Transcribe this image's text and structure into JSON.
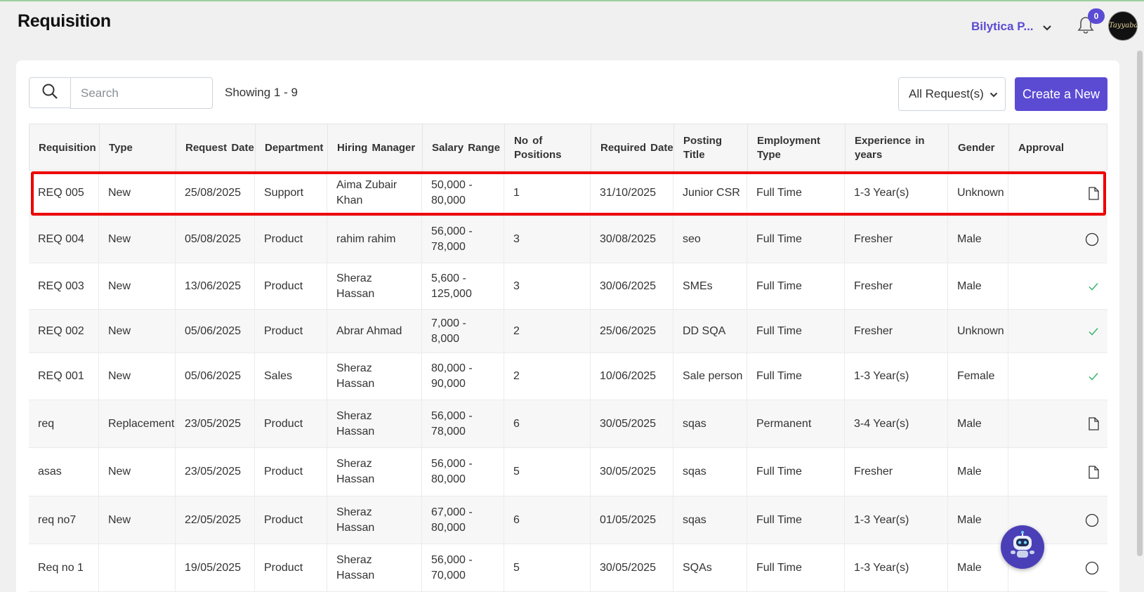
{
  "header": {
    "title": "Requisition",
    "company": "Bilytica P...",
    "notification_count": "0",
    "avatar_text": "Tayyaba"
  },
  "toolbar": {
    "search_placeholder": "Search",
    "search_value": "",
    "showing": "Showing 1 - 9",
    "filter_label": "All Request(s)",
    "create_label": "Create a New"
  },
  "table": {
    "columns": [
      "Requisition",
      "Type",
      "Request Date",
      "Department",
      "Hiring Manager",
      "Salary Range",
      "No of Positions",
      "Required Date",
      "Posting Title",
      "Employment Type",
      "Experience in years",
      "Gender",
      "Approval"
    ],
    "rows": [
      {
        "requisition": "REQ 005",
        "type": "New",
        "request_date": "25/08/2025",
        "department": "Support",
        "hiring_manager": "Aima Zubair Khan",
        "salary_range": "50,000 - 80,000",
        "positions": "1",
        "required_date": "31/10/2025",
        "posting_title": "Junior CSR",
        "employment_type": "Full Time",
        "experience": "1-3 Year(s)",
        "gender": "Unknown",
        "approval": "document-icon"
      },
      {
        "requisition": "REQ 004",
        "type": "New",
        "request_date": "05/08/2025",
        "department": "Product",
        "hiring_manager": "rahim rahim",
        "salary_range": "56,000 - 78,000",
        "positions": "3",
        "required_date": "30/08/2025",
        "posting_title": "seo",
        "employment_type": "Full Time",
        "experience": "Fresher",
        "gender": "Male",
        "approval": "circle-icon"
      },
      {
        "requisition": "REQ 003",
        "type": "New",
        "request_date": "13/06/2025",
        "department": "Product",
        "hiring_manager": "Sheraz Hassan",
        "salary_range": "5,600 - 125,000",
        "positions": "3",
        "required_date": "30/06/2025",
        "posting_title": "SMEs",
        "employment_type": "Full Time",
        "experience": "Fresher",
        "gender": "Male",
        "approval": "check-icon"
      },
      {
        "requisition": "REQ 002",
        "type": "New",
        "request_date": "05/06/2025",
        "department": "Product",
        "hiring_manager": "Abrar Ahmad",
        "salary_range": "7,000 - 8,000",
        "positions": "2",
        "required_date": "25/06/2025",
        "posting_title": "DD SQA",
        "employment_type": "Full Time",
        "experience": "Fresher",
        "gender": "Unknown",
        "approval": "check-icon"
      },
      {
        "requisition": "REQ 001",
        "type": "New",
        "request_date": "05/06/2025",
        "department": "Sales",
        "hiring_manager": "Sheraz Hassan",
        "salary_range": "80,000 - 90,000",
        "positions": "2",
        "required_date": "10/06/2025",
        "posting_title": "Sale person",
        "employment_type": "Full Time",
        "experience": "1-3 Year(s)",
        "gender": "Female",
        "approval": "check-icon"
      },
      {
        "requisition": "req",
        "type": "Replacement",
        "request_date": "23/05/2025",
        "department": "Product",
        "hiring_manager": "Sheraz Hassan",
        "salary_range": "56,000 - 78,000",
        "positions": "6",
        "required_date": "30/05/2025",
        "posting_title": "sqas",
        "employment_type": "Permanent",
        "experience": "3-4 Year(s)",
        "gender": "Male",
        "approval": "document-icon"
      },
      {
        "requisition": "asas",
        "type": "New",
        "request_date": "23/05/2025",
        "department": "Product",
        "hiring_manager": "Sheraz Hassan",
        "salary_range": "56,000 - 80,000",
        "positions": "5",
        "required_date": "30/05/2025",
        "posting_title": "sqas",
        "employment_type": "Full Time",
        "experience": "Fresher",
        "gender": "Male",
        "approval": "document-icon"
      },
      {
        "requisition": "req no7",
        "type": "New",
        "request_date": "22/05/2025",
        "department": "Product",
        "hiring_manager": "Sheraz Hassan",
        "salary_range": "67,000 - 80,000",
        "positions": "6",
        "required_date": "01/05/2025",
        "posting_title": "sqas",
        "employment_type": "Full Time",
        "experience": "1-3 Year(s)",
        "gender": "Male",
        "approval": "circle-icon"
      },
      {
        "requisition": "Req no 1",
        "type": "",
        "request_date": "19/05/2025",
        "department": "Product",
        "hiring_manager": "Sheraz Hassan",
        "salary_range": "56,000 - 70,000",
        "positions": "5",
        "required_date": "30/05/2025",
        "posting_title": "SQAs",
        "employment_type": "Full Time",
        "experience": "1-3 Year(s)",
        "gender": "Male",
        "approval": "circle-icon"
      }
    ]
  },
  "colors": {
    "accent": "#5b4bd3",
    "highlight": "#ee0000",
    "check": "#3cb371"
  }
}
